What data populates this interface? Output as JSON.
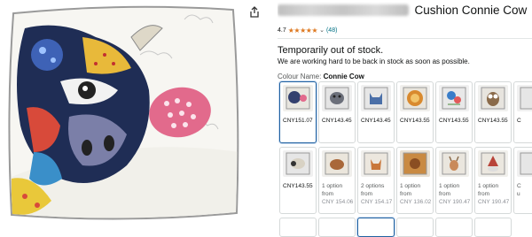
{
  "product": {
    "title_visible": "Cushion Connie Cow",
    "rating_value": "4.7",
    "rating_stars": "★★★★★",
    "rating_count": "(48)"
  },
  "stock": {
    "headline": "Temporarily out of stock.",
    "subline": "We are working hard to be back in stock as soon as possible."
  },
  "colour": {
    "label": "Colour Name:",
    "selected": "Connie Cow"
  },
  "swatches_row1": [
    {
      "name": "connie-cow",
      "price": "CNY151.07",
      "selected": true
    },
    {
      "name": "dog-patchwork",
      "price": "CNY143.45"
    },
    {
      "name": "cat-blue",
      "price": "CNY143.45"
    },
    {
      "name": "lion-orange",
      "price": "CNY143.55"
    },
    {
      "name": "bird-flowers",
      "price": "CNY143.55"
    },
    {
      "name": "owl-patchwork",
      "price": "CNY143.55"
    },
    {
      "name": "partial",
      "price": "C"
    }
  ],
  "swatches_row2": [
    {
      "name": "sheep-patchwork",
      "price": "CNY143.55"
    },
    {
      "name": "hedgehog",
      "line1": "1 option",
      "line2": "from",
      "line3": "CNY 154.06"
    },
    {
      "name": "fox-kitten",
      "line1": "2 options",
      "line2": "from",
      "line3": "CNY 154.17"
    },
    {
      "name": "highland-cow",
      "line1": "1 option",
      "line2": "from",
      "line3": "CNY 136.02"
    },
    {
      "name": "stag",
      "line1": "1 option",
      "line2": "from",
      "line3": "CNY 190.47"
    },
    {
      "name": "gnome",
      "line1": "1 option",
      "line2": "from",
      "line3": "CNY 190.47"
    },
    {
      "name": "partial",
      "line1": "C",
      "line2": "u"
    }
  ],
  "icons": {
    "share": "share-icon",
    "chevron": "⌄"
  },
  "colors": {
    "link": "#007185",
    "star": "#de7921",
    "selected_border": "#2162a1"
  }
}
